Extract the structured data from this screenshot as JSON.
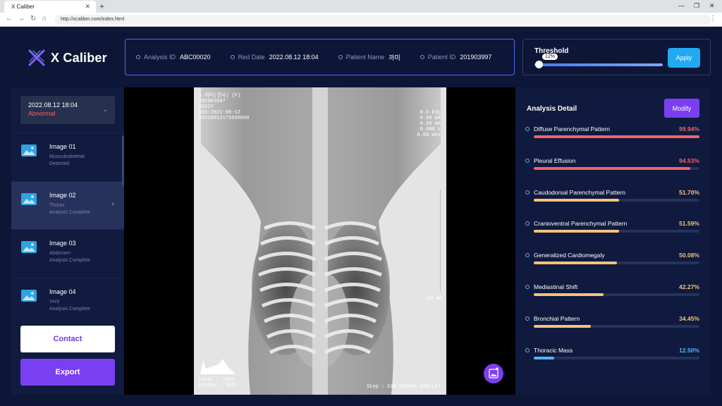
{
  "browser": {
    "tab_title": "X Caliber",
    "url": "http://xcaliber.com/index.html"
  },
  "brand": {
    "name": "X Caliber"
  },
  "analysis_info": [
    {
      "label": "Analysis ID",
      "value": "ABC00020"
    },
    {
      "label": "Red Date",
      "value": "2022.08.12 18:04"
    },
    {
      "label": "Patient Name",
      "value": "까미"
    },
    {
      "label": "Patient ID",
      "value": "201903997"
    }
  ],
  "threshold": {
    "title": "Threshold",
    "value_label": "12%",
    "value": 12,
    "apply_label": "Apply"
  },
  "sidebar": {
    "date": "2022.08.12 18:04",
    "status": "Abnormal",
    "images": [
      {
        "title": "Image 01",
        "region": "Musculoskeletal",
        "status": "Detected"
      },
      {
        "title": "Image 02",
        "region": "Thorax",
        "status": "Analysis Complete"
      },
      {
        "title": "Image 03",
        "region": "Abdomen",
        "status": "Analysis Complete"
      },
      {
        "title": "Image 04",
        "region": "VHS",
        "status": "Analysis Complete"
      }
    ],
    "contact_label": "Contact",
    "export_label": "Export"
  },
  "viewer": {
    "overlay_tl": [
      "1 까미(견사) (F)",
      "201903997",
      "2022Y",
      "DOS:2022-08-12",
      "20220812175930000"
    ],
    "overlay_tr": [
      "0.0 kVp",
      "0.00 mA",
      "0.00 mA",
      "0.000 s",
      "0.00 mAs"
    ],
    "scale_label": "94 mm",
    "level": "Level : 1991",
    "window": "Window : 3851",
    "step": "Step : CAN_THORAX CAN/LAT"
  },
  "analysis_detail": {
    "title": "Analysis Detail",
    "modify_label": "Modify",
    "findings": [
      {
        "name": "Diffuse Parenchymal Pattern",
        "value": "99.94%",
        "pct": 99.94,
        "color": "#f0636a"
      },
      {
        "name": "Pleural Effusion",
        "value": "94.53%",
        "pct": 94.53,
        "color": "#f0636a"
      },
      {
        "name": "Caudodorsal Parenchymal Pattern",
        "value": "51.70%",
        "pct": 51.7,
        "color": "#f7c27b"
      },
      {
        "name": "Cranioventral Parenchymal Pattern",
        "value": "51.59%",
        "pct": 51.59,
        "color": "#f7c27b"
      },
      {
        "name": "Generalized Cardiomegaly",
        "value": "50.08%",
        "pct": 50.08,
        "color": "#f7c27b"
      },
      {
        "name": "Mediastinal Shift",
        "value": "42.27%",
        "pct": 42.27,
        "color": "#f7c27b"
      },
      {
        "name": "Bronchial Pattern",
        "value": "34.45%",
        "pct": 34.45,
        "color": "#f7c27b"
      },
      {
        "name": "Thoracic Mass",
        "value": "12.50%",
        "pct": 12.5,
        "color": "#4fb6ff"
      }
    ]
  }
}
